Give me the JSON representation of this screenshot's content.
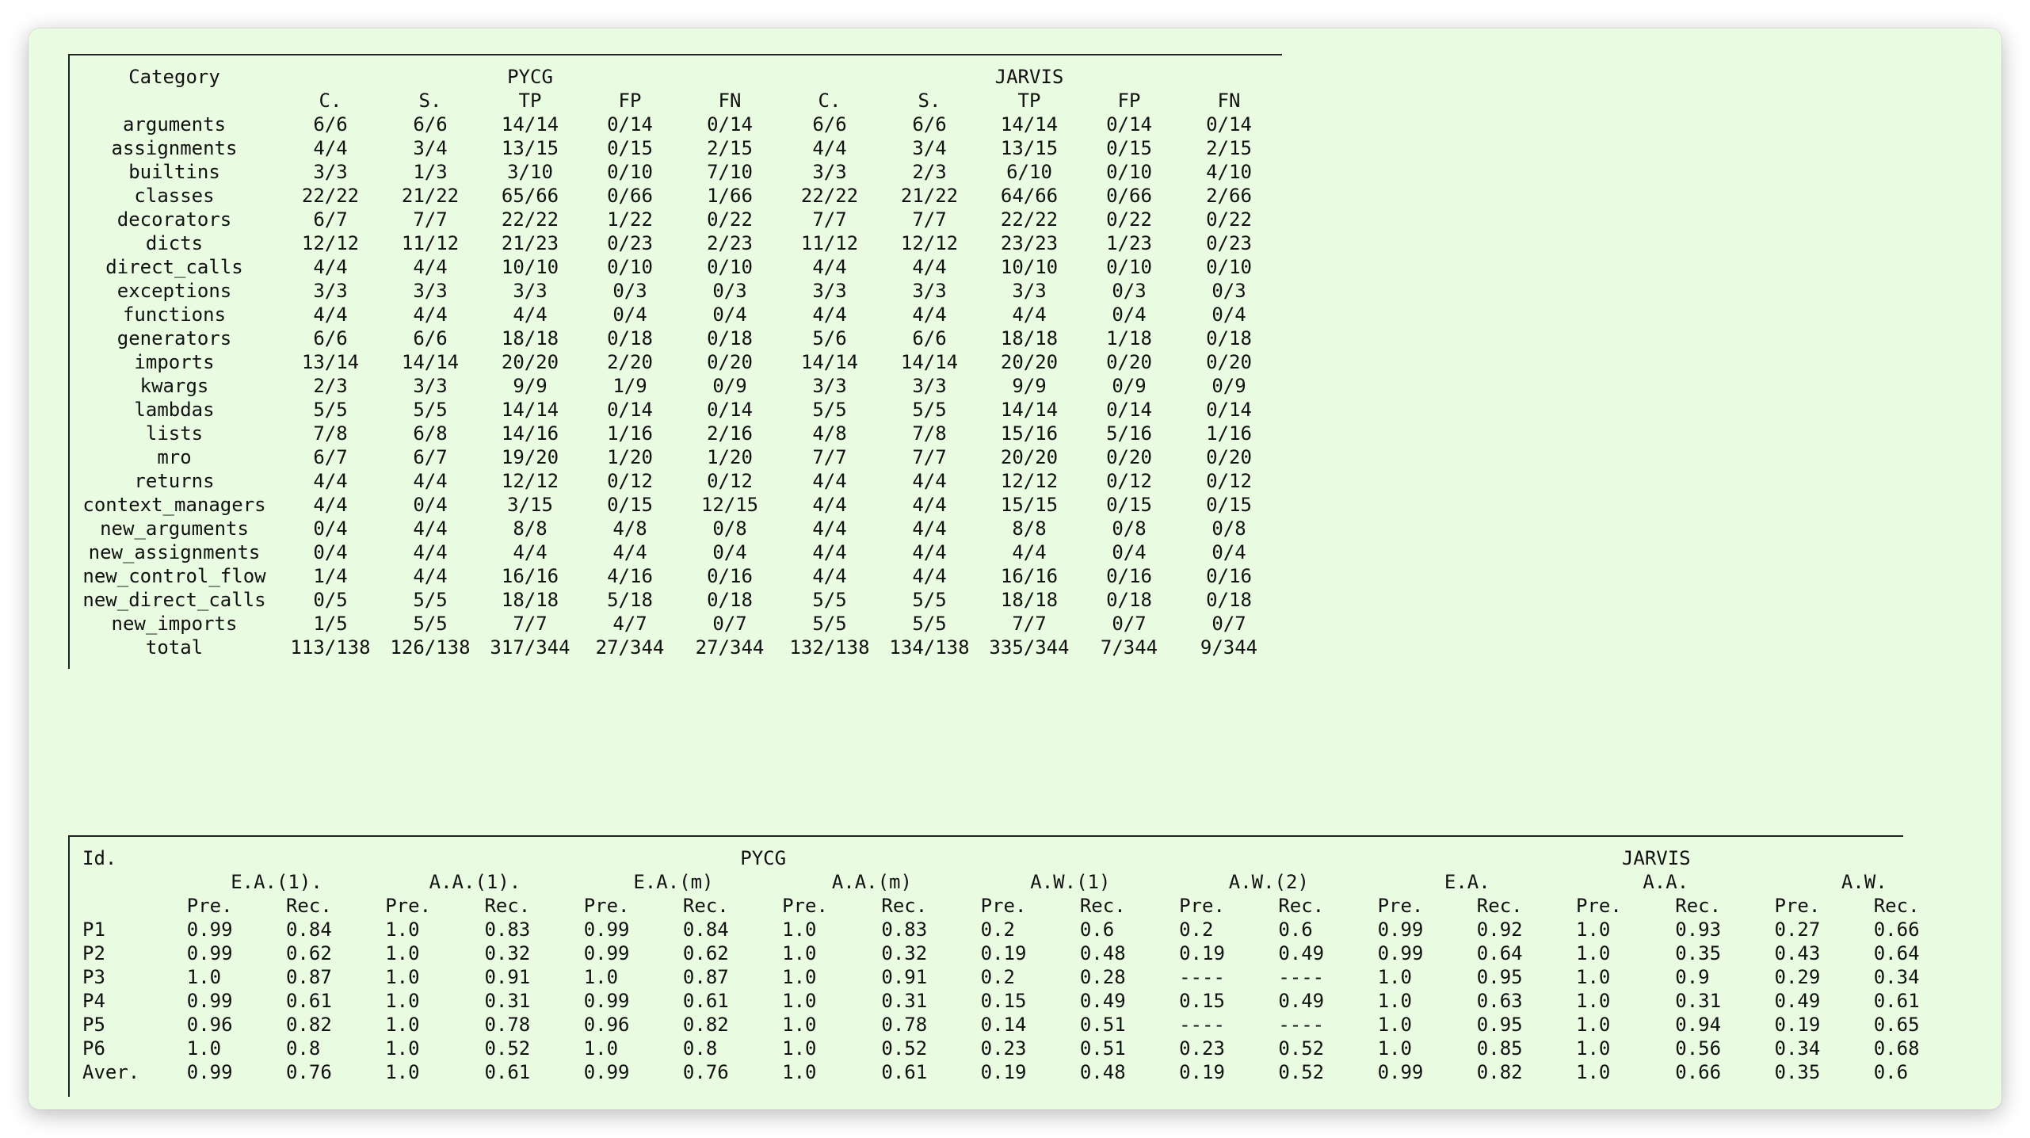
{
  "table1": {
    "category_label": "Category",
    "group_labels": [
      "PYCG",
      "JARVIS"
    ],
    "sub_headers": [
      "C.",
      "S.",
      "TP",
      "FP",
      "FN",
      "C.",
      "S.",
      "TP",
      "FP",
      "FN"
    ],
    "rows": [
      [
        "arguments",
        "6/6",
        "6/6",
        "14/14",
        "0/14",
        "0/14",
        "6/6",
        "6/6",
        "14/14",
        "0/14",
        "0/14"
      ],
      [
        "assignments",
        "4/4",
        "3/4",
        "13/15",
        "0/15",
        "2/15",
        "4/4",
        "3/4",
        "13/15",
        "0/15",
        "2/15"
      ],
      [
        "builtins",
        "3/3",
        "1/3",
        "3/10",
        "0/10",
        "7/10",
        "3/3",
        "2/3",
        "6/10",
        "0/10",
        "4/10"
      ],
      [
        "classes",
        "22/22",
        "21/22",
        "65/66",
        "0/66",
        "1/66",
        "22/22",
        "21/22",
        "64/66",
        "0/66",
        "2/66"
      ],
      [
        "decorators",
        "6/7",
        "7/7",
        "22/22",
        "1/22",
        "0/22",
        "7/7",
        "7/7",
        "22/22",
        "0/22",
        "0/22"
      ],
      [
        "dicts",
        "12/12",
        "11/12",
        "21/23",
        "0/23",
        "2/23",
        "11/12",
        "12/12",
        "23/23",
        "1/23",
        "0/23"
      ],
      [
        "direct_calls",
        "4/4",
        "4/4",
        "10/10",
        "0/10",
        "0/10",
        "4/4",
        "4/4",
        "10/10",
        "0/10",
        "0/10"
      ],
      [
        "exceptions",
        "3/3",
        "3/3",
        "3/3",
        "0/3",
        "0/3",
        "3/3",
        "3/3",
        "3/3",
        "0/3",
        "0/3"
      ],
      [
        "functions",
        "4/4",
        "4/4",
        "4/4",
        "0/4",
        "0/4",
        "4/4",
        "4/4",
        "4/4",
        "0/4",
        "0/4"
      ],
      [
        "generators",
        "6/6",
        "6/6",
        "18/18",
        "0/18",
        "0/18",
        "5/6",
        "6/6",
        "18/18",
        "1/18",
        "0/18"
      ],
      [
        "imports",
        "13/14",
        "14/14",
        "20/20",
        "2/20",
        "0/20",
        "14/14",
        "14/14",
        "20/20",
        "0/20",
        "0/20"
      ],
      [
        "kwargs",
        "2/3",
        "3/3",
        "9/9",
        "1/9",
        "0/9",
        "3/3",
        "3/3",
        "9/9",
        "0/9",
        "0/9"
      ],
      [
        "lambdas",
        "5/5",
        "5/5",
        "14/14",
        "0/14",
        "0/14",
        "5/5",
        "5/5",
        "14/14",
        "0/14",
        "0/14"
      ],
      [
        "lists",
        "7/8",
        "6/8",
        "14/16",
        "1/16",
        "2/16",
        "4/8",
        "7/8",
        "15/16",
        "5/16",
        "1/16"
      ],
      [
        "mro",
        "6/7",
        "6/7",
        "19/20",
        "1/20",
        "1/20",
        "7/7",
        "7/7",
        "20/20",
        "0/20",
        "0/20"
      ],
      [
        "returns",
        "4/4",
        "4/4",
        "12/12",
        "0/12",
        "0/12",
        "4/4",
        "4/4",
        "12/12",
        "0/12",
        "0/12"
      ],
      [
        "context_managers",
        "4/4",
        "0/4",
        "3/15",
        "0/15",
        "12/15",
        "4/4",
        "4/4",
        "15/15",
        "0/15",
        "0/15"
      ],
      [
        "new_arguments",
        "0/4",
        "4/4",
        "8/8",
        "4/8",
        "0/8",
        "4/4",
        "4/4",
        "8/8",
        "0/8",
        "0/8"
      ],
      [
        "new_assignments",
        "0/4",
        "4/4",
        "4/4",
        "4/4",
        "0/4",
        "4/4",
        "4/4",
        "4/4",
        "0/4",
        "0/4"
      ],
      [
        "new_control_flow",
        "1/4",
        "4/4",
        "16/16",
        "4/16",
        "0/16",
        "4/4",
        "4/4",
        "16/16",
        "0/16",
        "0/16"
      ],
      [
        "new_direct_calls",
        "0/5",
        "5/5",
        "18/18",
        "5/18",
        "0/18",
        "5/5",
        "5/5",
        "18/18",
        "0/18",
        "0/18"
      ],
      [
        "new_imports",
        "1/5",
        "5/5",
        "7/7",
        "4/7",
        "0/7",
        "5/5",
        "5/5",
        "7/7",
        "0/7",
        "0/7"
      ],
      [
        "total",
        "113/138",
        "126/138",
        "317/344",
        "27/344",
        "27/344",
        "132/138",
        "134/138",
        "335/344",
        "7/344",
        "9/344"
      ]
    ]
  },
  "table2": {
    "id_label": "Id.",
    "group_labels": [
      "PYCG",
      "JARVIS"
    ],
    "method_labels": [
      "E.A.(1).",
      "A.A.(1).",
      "E.A.(m)",
      "A.A.(m)",
      "A.W.(1)",
      "A.W.(2)",
      "E.A.",
      "A.A.",
      "A.W."
    ],
    "metric_labels": [
      "Pre.",
      "Rec."
    ],
    "rows": [
      [
        "P1",
        "0.99",
        "0.84",
        "1.0",
        "0.83",
        "0.99",
        "0.84",
        "1.0",
        "0.83",
        "0.2",
        "0.6",
        "0.2",
        "0.6",
        "0.99",
        "0.92",
        "1.0",
        "0.93",
        "0.27",
        "0.66"
      ],
      [
        "P2",
        "0.99",
        "0.62",
        "1.0",
        "0.32",
        "0.99",
        "0.62",
        "1.0",
        "0.32",
        "0.19",
        "0.48",
        "0.19",
        "0.49",
        "0.99",
        "0.64",
        "1.0",
        "0.35",
        "0.43",
        "0.64"
      ],
      [
        "P3",
        "1.0",
        "0.87",
        "1.0",
        "0.91",
        "1.0",
        "0.87",
        "1.0",
        "0.91",
        "0.2",
        "0.28",
        "----",
        "----",
        "1.0",
        "0.95",
        "1.0",
        "0.9",
        "0.29",
        "0.34"
      ],
      [
        "P4",
        "0.99",
        "0.61",
        "1.0",
        "0.31",
        "0.99",
        "0.61",
        "1.0",
        "0.31",
        "0.15",
        "0.49",
        "0.15",
        "0.49",
        "1.0",
        "0.63",
        "1.0",
        "0.31",
        "0.49",
        "0.61"
      ],
      [
        "P5",
        "0.96",
        "0.82",
        "1.0",
        "0.78",
        "0.96",
        "0.82",
        "1.0",
        "0.78",
        "0.14",
        "0.51",
        "----",
        "----",
        "1.0",
        "0.95",
        "1.0",
        "0.94",
        "0.19",
        "0.65"
      ],
      [
        "P6",
        "1.0",
        "0.8",
        "1.0",
        "0.52",
        "1.0",
        "0.8",
        "1.0",
        "0.52",
        "0.23",
        "0.51",
        "0.23",
        "0.52",
        "1.0",
        "0.85",
        "1.0",
        "0.56",
        "0.34",
        "0.68"
      ],
      [
        "Aver.",
        "0.99",
        "0.76",
        "1.0",
        "0.61",
        "0.99",
        "0.76",
        "1.0",
        "0.61",
        "0.19",
        "0.48",
        "0.19",
        "0.52",
        "0.99",
        "0.82",
        "1.0",
        "0.66",
        "0.35",
        "0.6"
      ]
    ]
  }
}
